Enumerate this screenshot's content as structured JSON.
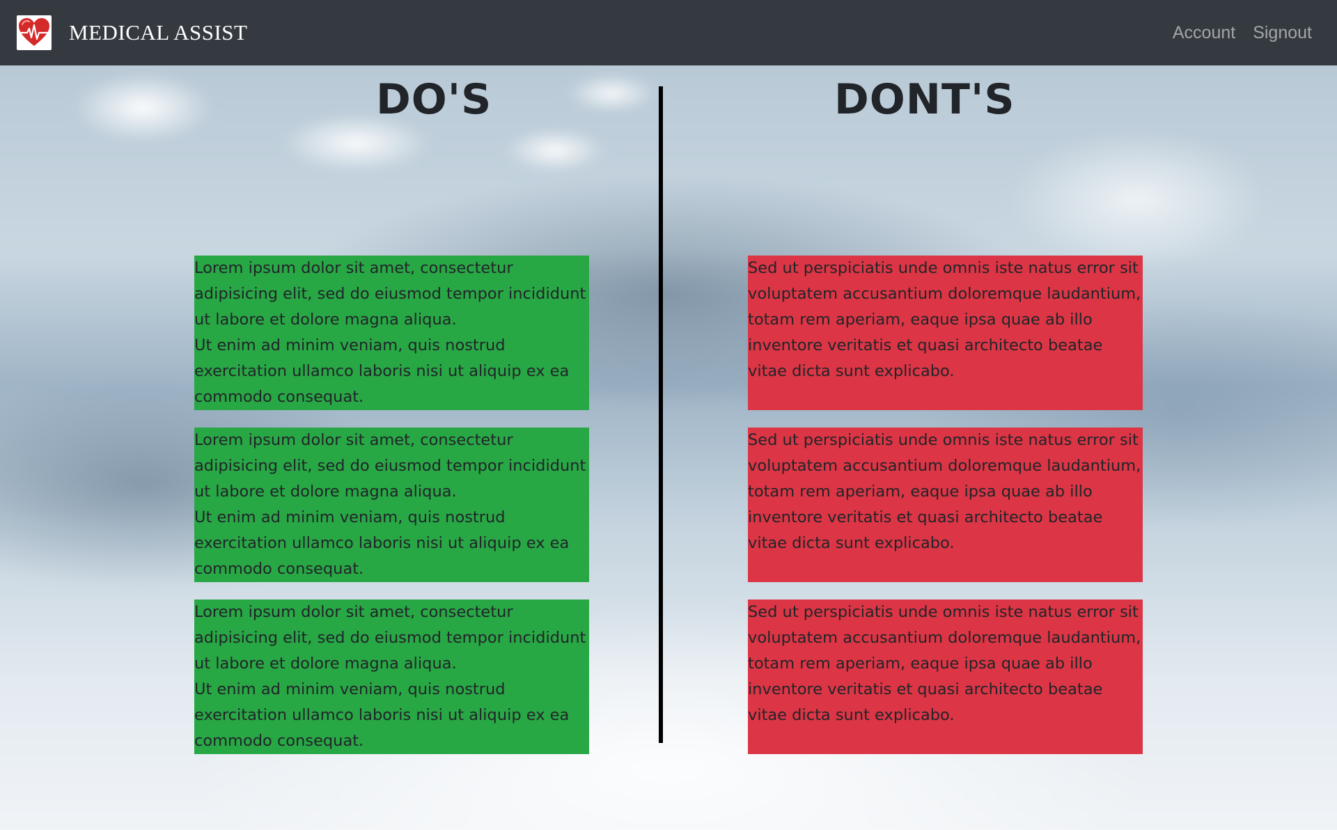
{
  "navbar": {
    "brand_title": "MEDICAL ASSIST",
    "logo_icon": "heart-pulse-icon",
    "links": [
      "Account",
      "Signout"
    ]
  },
  "colors": {
    "navbar_bg": "#343a40",
    "do_card": "#28a745",
    "dont_card": "#dc3545",
    "divider": "#000000"
  },
  "dos": {
    "heading": "DO'S",
    "cards": [
      {
        "line1": "Lorem ipsum dolor sit amet, consectetur adipisicing elit, sed do eiusmod tempor incididunt ut labore et dolore magna aliqua.",
        "line2": "Ut enim ad minim veniam, quis nostrud exercitation ullamco laboris nisi ut aliquip ex ea commodo consequat."
      },
      {
        "line1": "Lorem ipsum dolor sit amet, consectetur adipisicing elit, sed do eiusmod tempor incididunt ut labore et dolore magna aliqua.",
        "line2": "Ut enim ad minim veniam, quis nostrud exercitation ullamco laboris nisi ut aliquip ex ea commodo consequat."
      },
      {
        "line1": "Lorem ipsum dolor sit amet, consectetur adipisicing elit, sed do eiusmod tempor incididunt ut labore et dolore magna aliqua.",
        "line2": "Ut enim ad minim veniam, quis nostrud exercitation ullamco laboris nisi ut aliquip ex ea commodo consequat."
      }
    ]
  },
  "donts": {
    "heading": "DONT'S",
    "cards": [
      {
        "text": "Sed ut perspiciatis unde omnis iste natus error sit voluptatem accusantium doloremque laudantium, totam rem aperiam, eaque ipsa quae ab illo inventore veritatis et quasi architecto beatae vitae dicta sunt explicabo."
      },
      {
        "text": "Sed ut perspiciatis unde omnis iste natus error sit voluptatem accusantium doloremque laudantium, totam rem aperiam, eaque ipsa quae ab illo inventore veritatis et quasi architecto beatae vitae dicta sunt explicabo."
      },
      {
        "text": "Sed ut perspiciatis unde omnis iste natus error sit voluptatem accusantium doloremque laudantium, totam rem aperiam, eaque ipsa quae ab illo inventore veritatis et quasi architecto beatae vitae dicta sunt explicabo."
      }
    ]
  }
}
